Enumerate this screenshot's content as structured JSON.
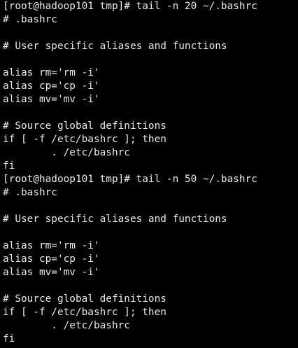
{
  "terminal": {
    "colors": {
      "background": "#000000",
      "foreground": "#e8e8e8"
    },
    "lines": [
      "[root@hadoop101 tmp]# tail -n 20 ~/.bashrc",
      "# .bashrc",
      "",
      "# User specific aliases and functions",
      "",
      "alias rm='rm -i'",
      "alias cp='cp -i'",
      "alias mv='mv -i'",
      "",
      "# Source global definitions",
      "if [ -f /etc/bashrc ]; then",
      "        . /etc/bashrc",
      "fi",
      "[root@hadoop101 tmp]# tail -n 50 ~/.bashrc",
      "# .bashrc",
      "",
      "# User specific aliases and functions",
      "",
      "alias rm='rm -i'",
      "alias cp='cp -i'",
      "alias mv='mv -i'",
      "",
      "# Source global definitions",
      "if [ -f /etc/bashrc ]; then",
      "        . /etc/bashrc",
      "fi"
    ]
  }
}
